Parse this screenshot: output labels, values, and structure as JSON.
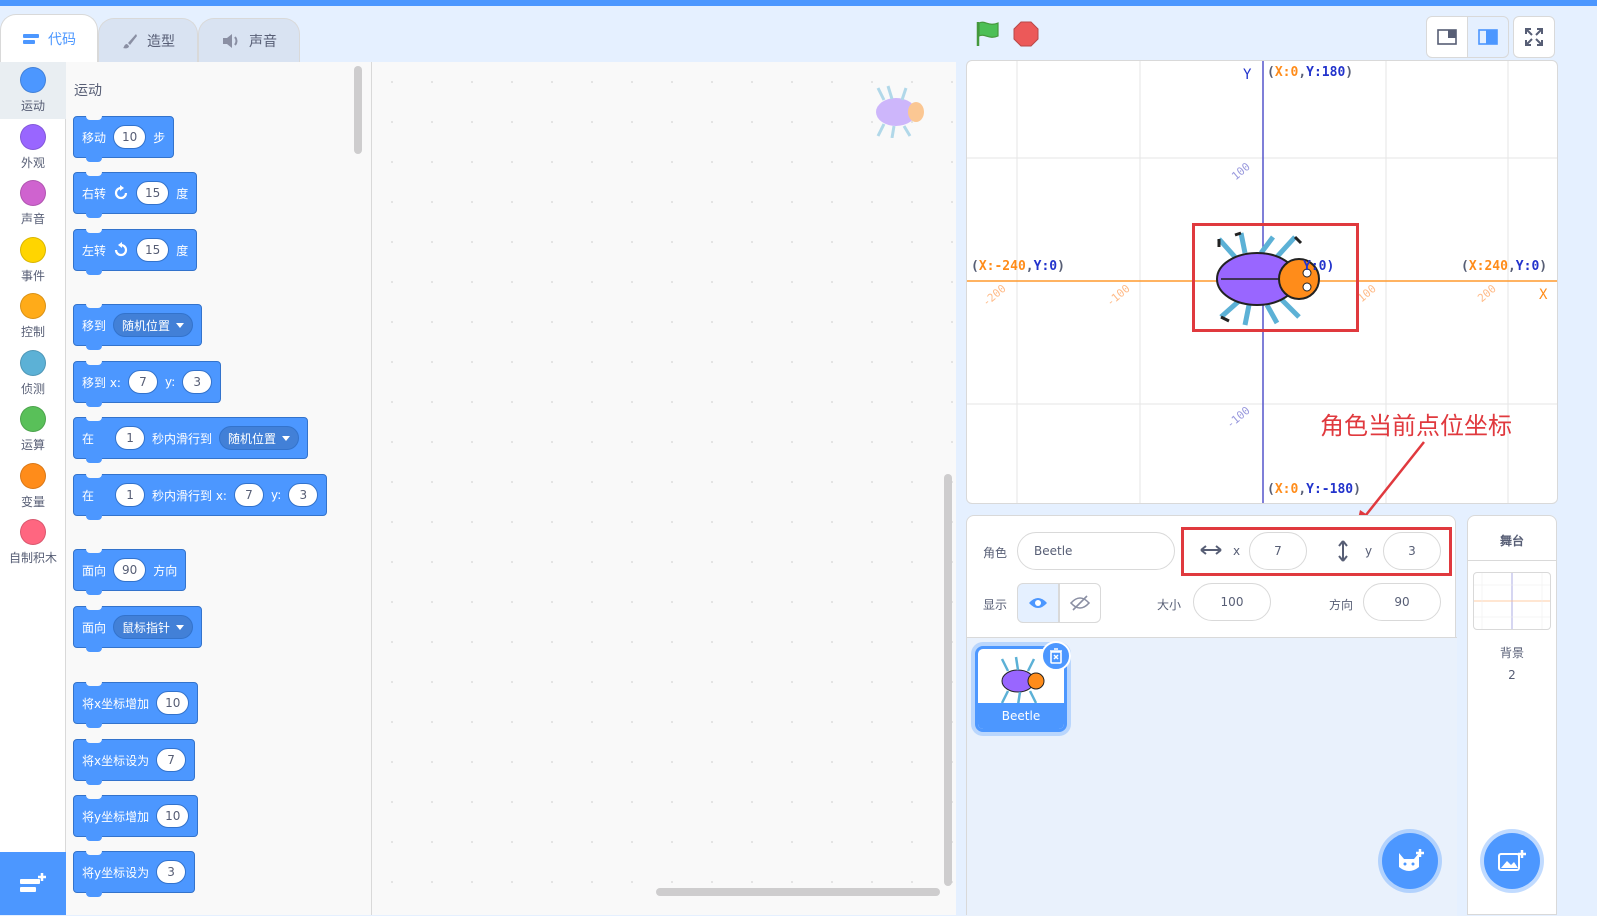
{
  "tabs": [
    {
      "label": "代码"
    },
    {
      "label": "造型"
    },
    {
      "label": "声音"
    }
  ],
  "categories": [
    {
      "label": "运动",
      "color": "#4c97ff"
    },
    {
      "label": "外观",
      "color": "#9966ff"
    },
    {
      "label": "声音",
      "color": "#cf63cf"
    },
    {
      "label": "事件",
      "color": "#ffd500"
    },
    {
      "label": "控制",
      "color": "#ffab19"
    },
    {
      "label": "侦测",
      "color": "#5cb1d6"
    },
    {
      "label": "运算",
      "color": "#59c059"
    },
    {
      "label": "变量",
      "color": "#ff8c1a"
    },
    {
      "label": "自制积木",
      "color": "#ff6680"
    }
  ],
  "palette": {
    "title": "运动",
    "move": {
      "a": "移动",
      "v": "10",
      "b": "步"
    },
    "turn_right": {
      "a": "右转",
      "v": "15",
      "b": "度"
    },
    "turn_left": {
      "a": "左转",
      "v": "15",
      "b": "度"
    },
    "goto": {
      "a": "移到",
      "dd": "随机位置"
    },
    "goto_xy": {
      "a": "移到 x:",
      "x": "7",
      "yl": "y:",
      "y": "3"
    },
    "glide": {
      "a": "在",
      "v": "1",
      "b": "秒内滑行到",
      "dd": "随机位置"
    },
    "glide_xy": {
      "a": "在",
      "v": "1",
      "b": "秒内滑行到 x:",
      "x": "7",
      "yl": "y:",
      "y": "3"
    },
    "point_dir": {
      "a": "面向",
      "v": "90",
      "b": "方向"
    },
    "point_towards": {
      "a": "面向",
      "dd": "鼠标指针"
    },
    "change_x": {
      "a": "将x坐标增加",
      "v": "10"
    },
    "set_x": {
      "a": "将x坐标设为",
      "v": "7"
    },
    "change_y": {
      "a": "将y坐标增加",
      "v": "10"
    },
    "set_y": {
      "a": "将y坐标设为",
      "v": "3"
    }
  },
  "stage": {
    "top": "(X:0,Y:180)",
    "top_x": "X:0",
    "top_y": "Y:180",
    "bottom_x": "X:0",
    "bottom_y": "Y:-180",
    "left_x": "X:-240",
    "left_y": "Y:0",
    "right_x": "X:240",
    "right_y": "Y:0",
    "sprite_coord": "Y:0)",
    "axis_y": "Y",
    "axis_x": "X",
    "ticks": {
      "y100": "100",
      "ym100": "-100",
      "xm200": "-200",
      "xm100": "-100",
      "x100": "100",
      "x200": "200"
    }
  },
  "sprite_info": {
    "sprite_label": "角色",
    "sprite_name": "Beetle",
    "x_label": "x",
    "x": "7",
    "y_label": "y",
    "y": "3",
    "show_label": "显示",
    "size_label": "大小",
    "size": "100",
    "direction_label": "方向",
    "direction": "90"
  },
  "annotation": "角色当前点位坐标",
  "sprites": [
    {
      "name": "Beetle"
    }
  ],
  "stage_panel": {
    "title": "舞台",
    "backdrop_label": "背景",
    "backdrop_count": "2"
  }
}
